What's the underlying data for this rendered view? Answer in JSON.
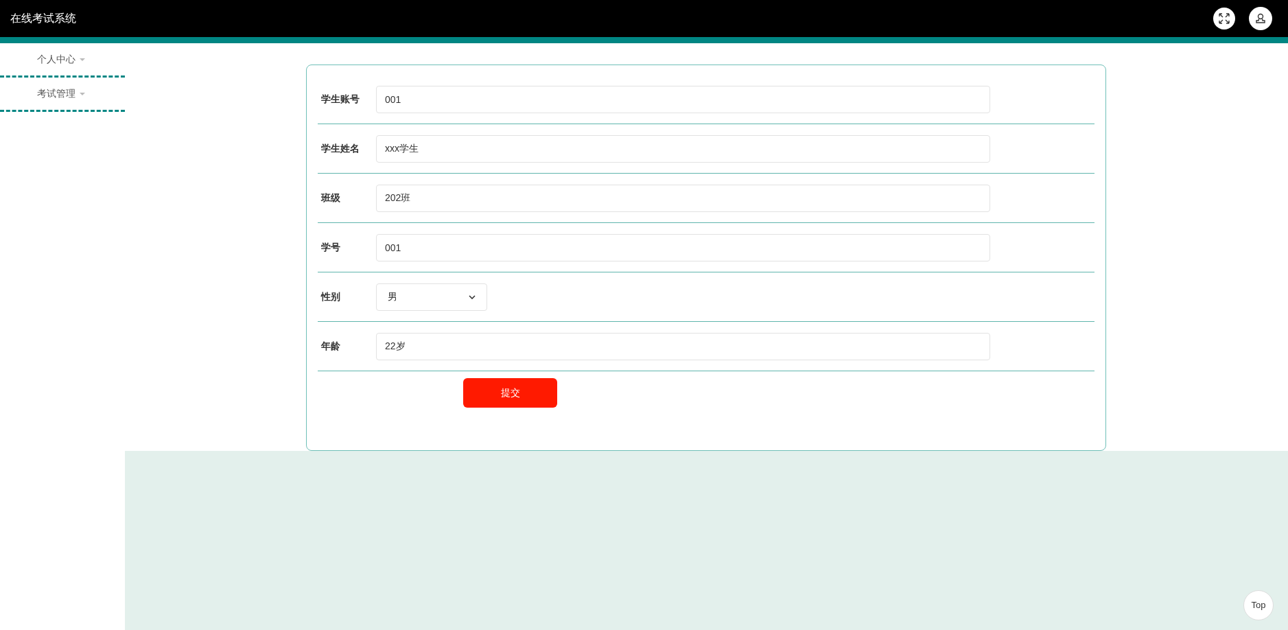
{
  "header": {
    "title": "在线考试系统"
  },
  "sidebar": {
    "items": [
      {
        "label": "个人中心",
        "expanded": false
      },
      {
        "label": "考试管理",
        "expanded": false
      }
    ]
  },
  "form": {
    "fields": [
      {
        "kind": "text",
        "label": "学生账号",
        "value": "001"
      },
      {
        "kind": "text",
        "label": "学生姓名",
        "value": "xxx学生"
      },
      {
        "kind": "text",
        "label": "班级",
        "value": "202班"
      },
      {
        "kind": "text",
        "label": "学号",
        "value": "001"
      },
      {
        "kind": "select",
        "label": "性别",
        "value": "男"
      },
      {
        "kind": "text",
        "label": "年龄",
        "value": "22岁"
      }
    ],
    "submit": "提交"
  },
  "back_to_top": "Top"
}
